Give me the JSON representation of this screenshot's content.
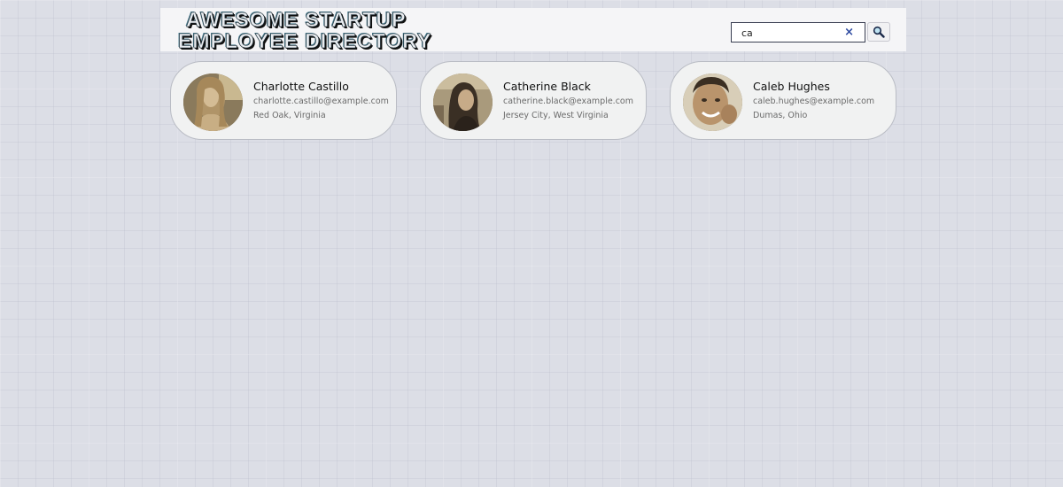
{
  "header": {
    "title_line1": "AWESOME STARTUP",
    "title_line2": "EMPLOYEE DIRECTORY"
  },
  "search": {
    "value": "ca",
    "placeholder": "",
    "clear_icon": "×",
    "search_icon_name": "magnifier-icon"
  },
  "employees": [
    {
      "name": "Charlotte Castillo",
      "email": "charlotte.castillo@example.com",
      "location": "Red Oak, Virginia"
    },
    {
      "name": "Catherine Black",
      "email": "catherine.black@example.com",
      "location": "Jersey City, West Virginia"
    },
    {
      "name": "Caleb Hughes",
      "email": "caleb.hughes@example.com",
      "location": "Dumas, Ohio"
    }
  ],
  "colors": {
    "background": "#dcdee6",
    "card": "#f1f2f2",
    "clear_icon": "#2d4aa0"
  }
}
